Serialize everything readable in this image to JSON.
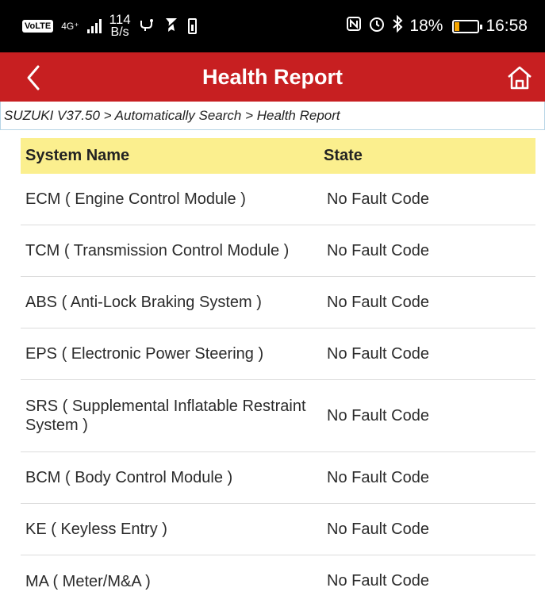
{
  "status_bar": {
    "volte": "VoLTE",
    "network": "4G⁺",
    "speed_value": "114",
    "speed_unit": "B/s",
    "battery_percent": "18%",
    "battery_level": 0.18,
    "time": "16:58",
    "battery_color": "#f7a600",
    "icons": [
      "usb-icon",
      "location-off-icon",
      "battery-alert-icon",
      "nfc-icon",
      "alarm-icon",
      "bluetooth-icon"
    ]
  },
  "header": {
    "title": "Health Report",
    "background": "#c71f21",
    "back_icon": "chevron-left-icon",
    "home_icon": "home-icon"
  },
  "breadcrumb": "SUZUKI V37.50 > Automatically Search > Health Report",
  "table": {
    "header_background": "#fbef8e",
    "columns": [
      "System Name",
      "State"
    ],
    "rows": [
      {
        "name": "ECM ( Engine Control Module )",
        "state": "No Fault Code"
      },
      {
        "name": "TCM ( Transmission Control Module )",
        "state": "No Fault Code"
      },
      {
        "name": "ABS ( Anti-Lock Braking System )",
        "state": "No Fault Code"
      },
      {
        "name": "EPS ( Electronic Power Steering )",
        "state": "No Fault Code"
      },
      {
        "name": "SRS ( Supplemental Inflatable Restraint System )",
        "state": "No Fault Code"
      },
      {
        "name": "BCM ( Body Control Module )",
        "state": "No Fault Code"
      },
      {
        "name": "KE ( Keyless Entry )",
        "state": "No Fault Code"
      },
      {
        "name": "MA ( Meter/M&A )",
        "state": "No Fault Code"
      }
    ]
  }
}
